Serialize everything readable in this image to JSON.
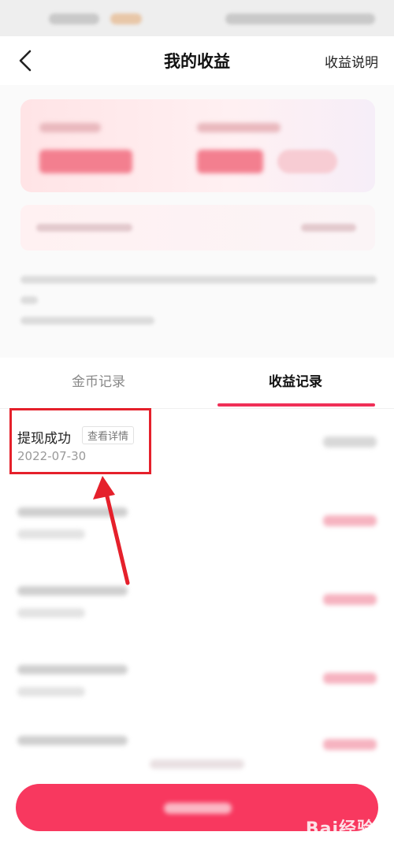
{
  "header": {
    "title": "我的收益",
    "right_link": "收益说明"
  },
  "tabs": [
    {
      "label": "金币记录",
      "active": false
    },
    {
      "label": "收益记录",
      "active": true
    }
  ],
  "records": [
    {
      "title": "提现成功",
      "tag": "查看详情",
      "date": "2022-07-30"
    }
  ],
  "watermark": "Bai经验",
  "colors": {
    "accent": "#f02f57",
    "button": "#f8385f",
    "highlight": "#e5202b"
  }
}
